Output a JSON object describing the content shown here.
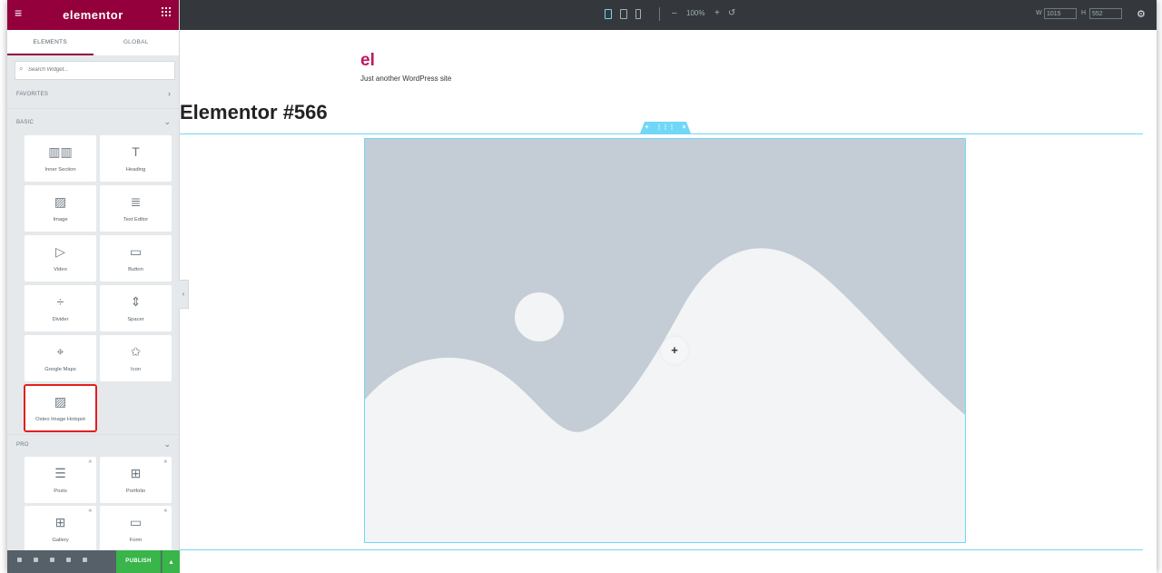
{
  "sidebar": {
    "logo": "elementor",
    "tabs": [
      {
        "label": "ELEMENTS"
      },
      {
        "label": "GLOBAL"
      }
    ],
    "search_placeholder": "Search Widget...",
    "categories": {
      "favorites": "FAVORITES",
      "basic": "BASIC",
      "pro": "PRO"
    },
    "widgets_basic": [
      {
        "label": "Inner Section",
        "icon": "inner-section-icon"
      },
      {
        "label": "Heading",
        "icon": "heading-icon"
      },
      {
        "label": "Image",
        "icon": "image-icon"
      },
      {
        "label": "Text Editor",
        "icon": "text-editor-icon"
      },
      {
        "label": "Video",
        "icon": "video-icon"
      },
      {
        "label": "Button",
        "icon": "button-icon"
      },
      {
        "label": "Divider",
        "icon": "divider-icon"
      },
      {
        "label": "Spacer",
        "icon": "spacer-icon"
      },
      {
        "label": "Google Maps",
        "icon": "google-maps-icon"
      },
      {
        "label": "Icon",
        "icon": "star-icon"
      },
      {
        "label": "Osteo Image Hotspot",
        "icon": "image-hotspot-icon"
      }
    ],
    "widgets_pro": [
      {
        "label": "Posts",
        "icon": "posts-icon"
      },
      {
        "label": "Portfolio",
        "icon": "portfolio-icon"
      },
      {
        "label": "Gallery",
        "icon": "gallery-icon"
      },
      {
        "label": "Form",
        "icon": "form-icon"
      }
    ],
    "publish_label": "PUBLISH"
  },
  "topbar": {
    "zoom": "100%",
    "width_value": "1015",
    "height_value": "552"
  },
  "site": {
    "title": "el",
    "tagline": "Just another WordPress site"
  },
  "page": {
    "title": "Elementor #566"
  },
  "colors": {
    "brand": "#93003c",
    "accent": "#71d7f7",
    "publish": "#39b54a",
    "highlight": "#e02020"
  }
}
